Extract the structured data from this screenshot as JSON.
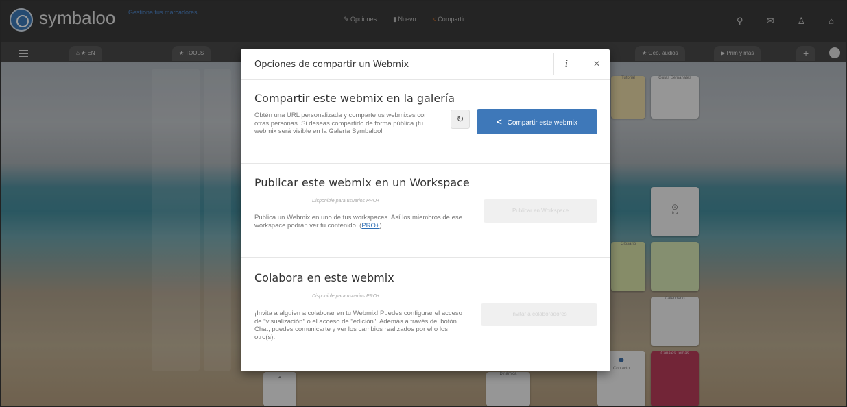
{
  "topbar": {
    "logo_text": "symbaloo",
    "slogan": "Gestiona tus marcadores",
    "menu": [
      {
        "label": "Opciones",
        "icon": "pencil-icon"
      },
      {
        "label": "Nuevo",
        "icon": "trash-icon"
      },
      {
        "label": "Compartir",
        "icon": "share-icon",
        "color": "#e47a2e"
      }
    ],
    "right_icons": [
      "search-icon",
      "mail-icon",
      "user-icon",
      "home-icon"
    ]
  },
  "tabs": [
    {
      "label": "EN"
    },
    {
      "label": "TOOLS"
    },
    {
      "label": "Geo. audios"
    },
    {
      "label": "Prim y más"
    }
  ],
  "tiles": {
    "tile_1": "Tutorial",
    "tile_2": "Guías Semanales",
    "tile_3": "Ir a",
    "tile_4": "Glosario",
    "tile_5": "Calendario",
    "tile_6": "Dinámica",
    "tile_7": "Contacto",
    "tile_8": "Canales Temas"
  },
  "dialog": {
    "title": "Opciones de compartir un Webmix",
    "info_label": "i",
    "close_label": "×",
    "section_share": {
      "title": "Compartir este webmix en la galería",
      "text": "Obtén una URL personalizada y comparte us webmixes con otras personas. Si deseas compartirlo de forma pública ¡tu webmix será visible en la Galería Symbaloo!",
      "button": "Compartir este webmix",
      "history_icon": "history-icon"
    },
    "section_workspace": {
      "title": "Publicar este webmix en un Workspace",
      "pro_note": "Disponible para usuarios PRO+",
      "text": "Publica un Webmix en uno de tus workspaces. Así los miembros de ese workspace podrán ver tu contenido. (",
      "link": "PRO+",
      "text_end": ")",
      "button": "Publicar en Workspace"
    },
    "section_collab": {
      "title": "Colabora en este webmix",
      "pro_note": "Disponible para usuarios PRO+",
      "text": "¡Invita a alguien a colaborar en tu Webmix! Puedes configurar el acceso de \"visualización\" o el acceso de \"edición\". Además a través del botón Chat, puedes comunicarte y ver los cambios realizados por el o los otro(s).",
      "button": "Invitar a colaboradores"
    }
  }
}
